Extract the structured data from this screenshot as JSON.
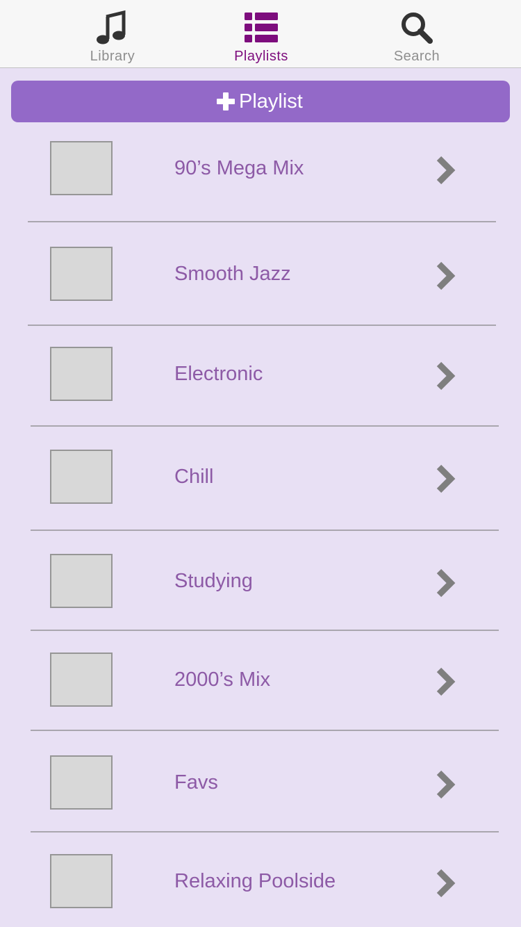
{
  "tabs": [
    {
      "label": "Library",
      "icon": "music-note-icon",
      "color": "#8e8e8e",
      "active": false
    },
    {
      "label": "Playlists",
      "icon": "list-icon",
      "color": "#7d0d7d",
      "active": true
    },
    {
      "label": "Search",
      "icon": "search-icon",
      "color": "#8e8e8e",
      "active": false
    }
  ],
  "add_button": {
    "icon": "plus-icon",
    "label": "Playlist"
  },
  "playlists": [
    {
      "title": "90’s Mega Mix"
    },
    {
      "title": "Smooth Jazz"
    },
    {
      "title": "Electronic"
    },
    {
      "title": "Chill"
    },
    {
      "title": "Studying"
    },
    {
      "title": "2000’s Mix"
    },
    {
      "title": "Favs"
    },
    {
      "title": "Relaxing Poolside"
    }
  ],
  "colors": {
    "background": "#e8e0f4",
    "accent": "#9369c8",
    "playlist_text": "#8d5aa6",
    "chevron": "#7f7f7f"
  }
}
